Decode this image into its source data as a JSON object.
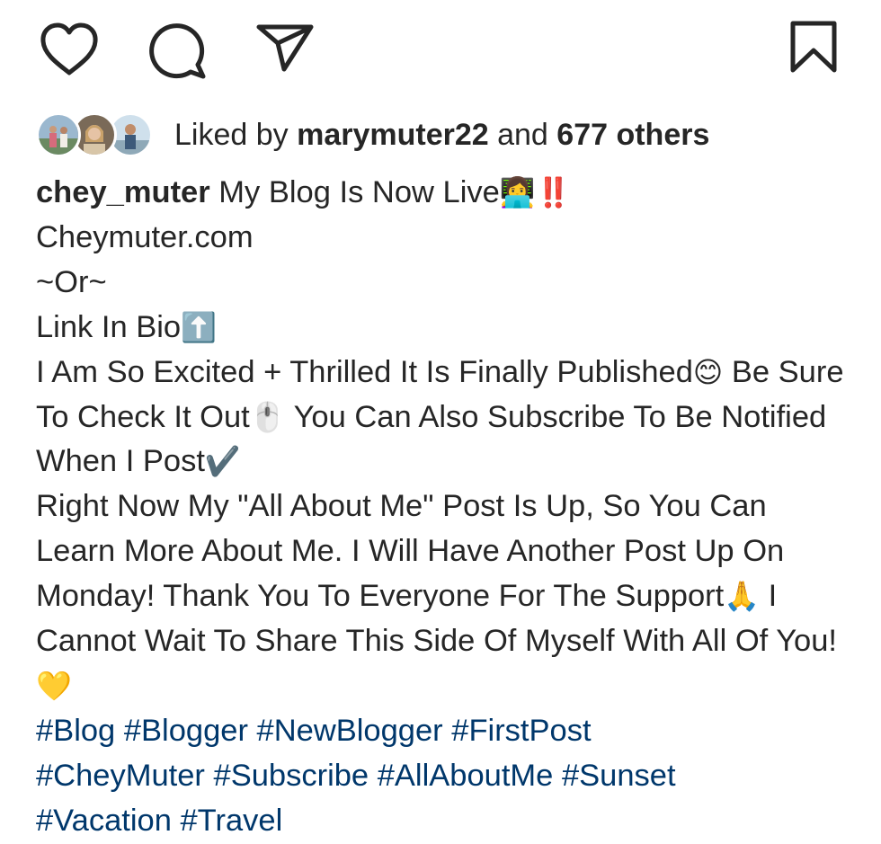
{
  "actions": {
    "like_icon": "heart-icon",
    "comment_icon": "comment-icon",
    "share_icon": "paper-plane-icon",
    "save_icon": "bookmark-icon"
  },
  "likes": {
    "prefix": "Liked by",
    "user": "marymuter22",
    "conjunction": "and",
    "others": "677 others"
  },
  "caption": {
    "username": "chey_muter",
    "lines": [
      " My Blog Is Now Live",
      "Cheymuter.com",
      "~Or~",
      "Link In Bio",
      "I Am So Excited + Thrilled It Is Finally Published",
      " Be Sure To Check It Out",
      " You Can Also Subscribe To Be Notified When I Post",
      "Right Now My \"All About Me\" Post Is Up, So You Can Learn More About Me. I Will Have Another Post Up On Monday! Thank You To Everyone For The Support",
      " I Cannot Wait To Share This Side Of Myself With All Of You!"
    ],
    "emojis": {
      "laptop": "👩‍💻",
      "exclamation": "‼️",
      "up_arrow": "⬆️",
      "smile": "😊",
      "mouse": "🖱️",
      "check": "✔️",
      "pray": "🙏",
      "heart": "💛"
    }
  },
  "hashtags": [
    "#Blog",
    "#Blogger",
    "#NewBlogger",
    "#FirstPost",
    "#CheyMuter",
    "#Subscribe",
    "#AllAboutMe",
    "#Sunset",
    "#Vacation",
    "#Travel"
  ],
  "colors": {
    "text": "#262626",
    "hashtag": "#00376b",
    "background": "#ffffff"
  }
}
